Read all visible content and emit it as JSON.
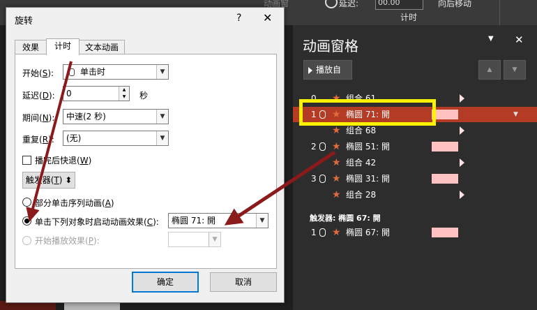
{
  "ribbon": {
    "delay_label": "延迟:",
    "delay_value": "00.00",
    "group_label": "计时",
    "move_later_label": "向后移动",
    "move_earlier_label": "动画窗"
  },
  "dialog": {
    "title": "旋转",
    "help": "?",
    "close": "✕",
    "tabs": [
      "效果",
      "计时",
      "文本动画"
    ],
    "start_label": "开始(",
    "start_key": "S",
    "start_value": "单击时",
    "delay_label": "延迟(",
    "delay_key": "D",
    "delay_value": "0",
    "delay_unit": "秒",
    "period_label": "期间(",
    "period_key": "N",
    "period_value": "中速(2 秒)",
    "repeat_label": "重复(",
    "repeat_key": "R",
    "repeat_value": "(无)",
    "rewind_label": "播完后快退(",
    "rewind_key": "W",
    "trigger_button": "触发器(",
    "trigger_key": "T",
    "option_sequence": "部分单击序列动画(",
    "option_sequence_key": "A",
    "option_click_object": "单击下列对象时启动动画效果(",
    "option_click_object_key": "C",
    "option_click_object_value": "椭圆 71: 開",
    "option_play_content": "开始播放效果(",
    "option_play_content_key": "P",
    "ok": "确定",
    "cancel": "取消"
  },
  "pane": {
    "title": "动画窗格",
    "dropdown": "▼",
    "close": "✕",
    "play_button": "播放自",
    "rows": [
      {
        "num": "0",
        "mouse": false,
        "name": "组合 61",
        "marker": "tri",
        "selected": false
      },
      {
        "num": "1",
        "mouse": true,
        "name": "椭圆 71: 開",
        "marker": "bar",
        "selected": true
      },
      {
        "num": "",
        "mouse": false,
        "name": "组合 68",
        "marker": "tri",
        "selected": false
      },
      {
        "num": "2",
        "mouse": true,
        "name": "椭圆 51: 開",
        "marker": "bar",
        "selected": false
      },
      {
        "num": "",
        "mouse": false,
        "name": "组合 42",
        "marker": "tri",
        "selected": false
      },
      {
        "num": "3",
        "mouse": true,
        "name": "椭圆 31: 開",
        "marker": "bar",
        "selected": false
      },
      {
        "num": "",
        "mouse": false,
        "name": "组合 28",
        "marker": "tri",
        "selected": false
      }
    ],
    "trigger_header": "触发器: 椭圆 67: 開",
    "trigger_row": {
      "num": "1",
      "mouse": true,
      "name": "椭圆 67: 開"
    }
  },
  "colors": {
    "accent_arrow": "#8b1a1a",
    "highlight": "#fff200",
    "selected_row": "#b43b24",
    "timing_bar": "#ffc2c0"
  }
}
